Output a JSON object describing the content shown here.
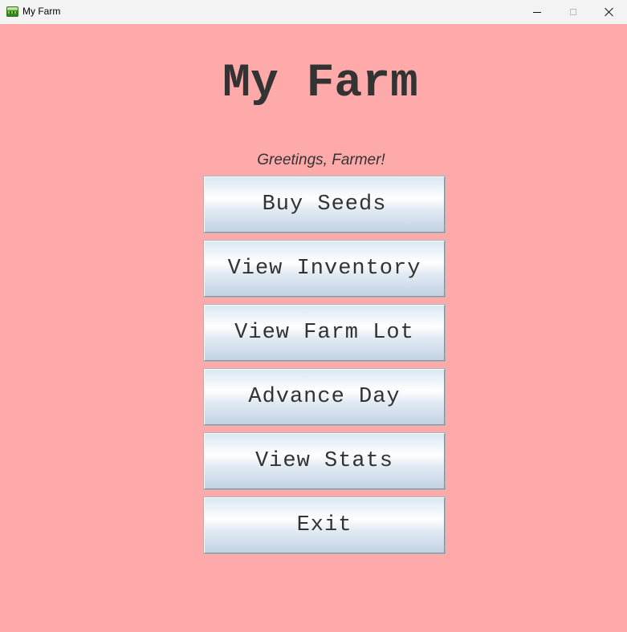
{
  "window": {
    "title": "My Farm",
    "icon": "farm-app-icon",
    "controls": {
      "minimize": "minimize-icon",
      "maximize": "maximize-icon",
      "close": "close-icon"
    }
  },
  "main": {
    "heading": "My Farm",
    "greeting": "Greetings, Farmer!",
    "buttons": [
      {
        "label": "Buy Seeds"
      },
      {
        "label": "View Inventory"
      },
      {
        "label": "View Farm Lot"
      },
      {
        "label": "Advance Day"
      },
      {
        "label": "View Stats"
      },
      {
        "label": "Exit"
      }
    ]
  },
  "colors": {
    "background": "#ffaaaa",
    "text": "#333333",
    "button_gradient_light": "#ffffff",
    "button_gradient_dark": "#c2d3e3",
    "titlebar": "#f3f3f3"
  }
}
